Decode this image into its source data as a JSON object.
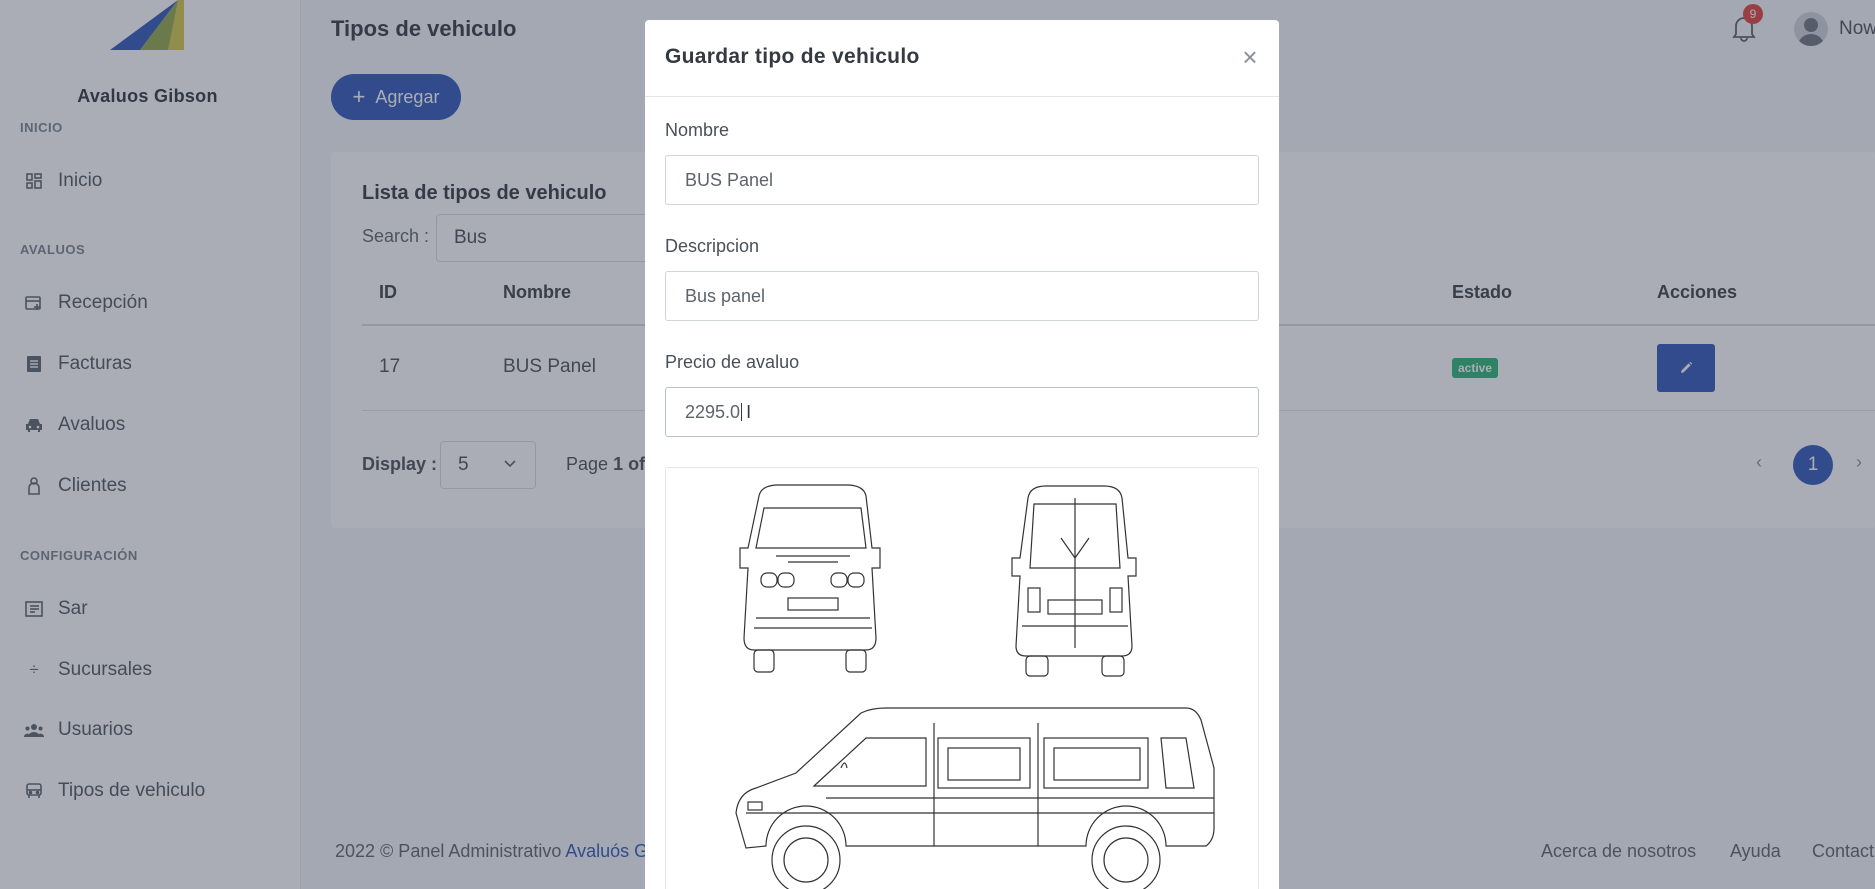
{
  "sidebar": {
    "brand": "Avaluos Gibson",
    "sections": {
      "inicio": "INICIO",
      "avaluos": "AVALUOS",
      "config": "CONFIGURACIÓN"
    },
    "items": [
      {
        "label": "Inicio",
        "icon": "dashboard-icon"
      },
      {
        "label": "Recepción",
        "icon": "reception-icon"
      },
      {
        "label": "Facturas",
        "icon": "invoice-icon"
      },
      {
        "label": "Avaluos",
        "icon": "car-icon"
      },
      {
        "label": "Clientes",
        "icon": "client-icon"
      },
      {
        "label": "Sar",
        "icon": "sar-icon"
      },
      {
        "label": "Sucursales",
        "icon": "divide-icon"
      },
      {
        "label": "Usuarios",
        "icon": "users-icon"
      },
      {
        "label": "Tipos de vehiculo",
        "icon": "vehicle-icon"
      }
    ]
  },
  "header": {
    "page_title": "Tipos de vehiculo",
    "add_button": "Agregar",
    "notifications_count": "9",
    "user_name": "Now"
  },
  "list": {
    "title": "Lista de tipos de vehiculo",
    "search_label": "Search :",
    "search_value": "Bus",
    "columns": {
      "id": "ID",
      "nombre": "Nombre",
      "estado": "Estado",
      "acciones": "Acciones"
    },
    "rows": [
      {
        "id": "17",
        "nombre": "BUS Panel",
        "estado": "active"
      }
    ],
    "display_label": "Display :",
    "display_value": "5",
    "page_prefix": "Page",
    "page_text": "1 of",
    "current_page": "1",
    "prev": "‹",
    "next": "›"
  },
  "footer": {
    "copy_prefix": "2022 © Panel Administrativo",
    "copy_link": "Avaluós G",
    "links": [
      "Acerca de nosotros",
      "Ayuda",
      "Contact"
    ]
  },
  "modal": {
    "title": "Guardar tipo de vehiculo",
    "close": "×",
    "fields": {
      "nombre_label": "Nombre",
      "nombre_value": "BUS Panel",
      "descripcion_label": "Descripcion",
      "descripcion_value": "Bus panel",
      "precio_label": "Precio de avaluo",
      "precio_value": "2295.0"
    }
  },
  "colors": {
    "primary": "#2f57b7",
    "success": "#2bb673",
    "danger": "#e2423b",
    "logo_blue": "#2f57b7",
    "logo_yellow": "#d8c94a"
  }
}
